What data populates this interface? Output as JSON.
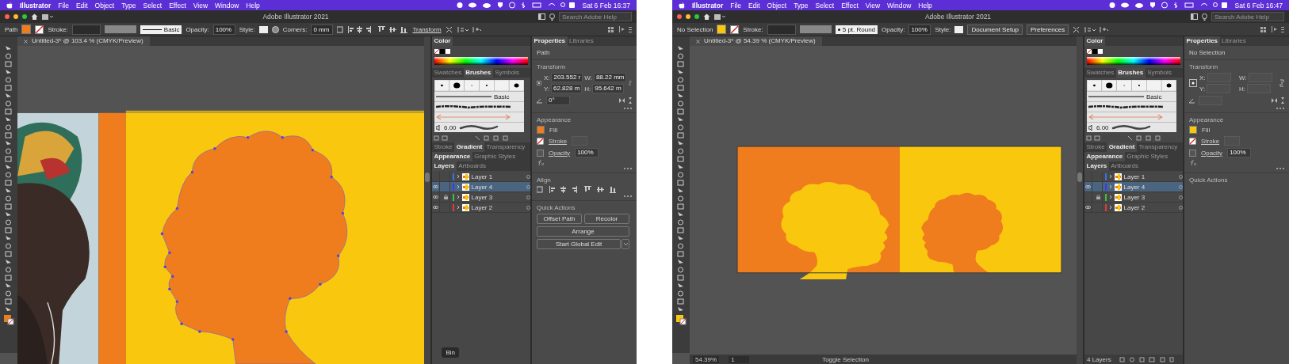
{
  "windows": [
    {
      "menu_bar": {
        "app": "Illustrator",
        "menus": [
          "File",
          "Edit",
          "Object",
          "Type",
          "Select",
          "Effect",
          "View",
          "Window",
          "Help"
        ],
        "clock": "Sat 6 Feb 16:37"
      },
      "title": "Adobe Illustrator 2021",
      "search": {
        "placeholder": "Search Adobe Help"
      },
      "control_bar": [
        {
          "kind": "label",
          "text": "Path"
        },
        {
          "kind": "swatch",
          "color": "#ef7d1d"
        },
        {
          "kind": "no-stroke"
        },
        {
          "kind": "label",
          "text": "Stroke:"
        },
        {
          "kind": "spinner"
        },
        {
          "kind": "grey-field"
        },
        {
          "kind": "brush",
          "text": "Basic"
        },
        {
          "kind": "label",
          "text": "Opacity:"
        },
        {
          "kind": "field",
          "text": "100%"
        },
        {
          "kind": "label",
          "text": "Style:"
        },
        {
          "kind": "style-swatch"
        },
        {
          "kind": "globe"
        },
        {
          "kind": "label",
          "text": "Corners:"
        },
        {
          "kind": "field",
          "text": "0 mm"
        },
        {
          "kind": "align-icons"
        },
        {
          "kind": "link",
          "text": "Transform"
        },
        {
          "kind": "more-icons"
        }
      ],
      "document_tab": "Untitled-3* @ 103.4 % (CMYK/Preview)",
      "artwork": {
        "kind": "portrait-edit"
      },
      "panels": {
        "color_tab": "Color",
        "brush_tabs": [
          {
            "label": "Swatches",
            "selected": false
          },
          {
            "label": "Brushes",
            "selected": true
          },
          {
            "label": "Symbols",
            "selected": false
          }
        ],
        "brush_label": "Basic",
        "brush_size": "6.00",
        "stroke_tabs": [
          {
            "label": "Stroke",
            "selected": false
          },
          {
            "label": "Gradient",
            "selected": true
          },
          {
            "label": "Transparency",
            "selected": false
          }
        ],
        "appearance_tabs": [
          {
            "label": "Appearance",
            "selected": true
          },
          {
            "label": "Graphic Styles",
            "selected": false
          }
        ],
        "layer_tabs": [
          {
            "label": "Layers",
            "selected": true
          },
          {
            "label": "Artboards",
            "selected": false
          }
        ],
        "layers": [
          {
            "name": "Layer 1",
            "visible": false,
            "locked": false,
            "color": "#3f6fe6",
            "selected": false
          },
          {
            "name": "Layer 4",
            "visible": true,
            "locked": false,
            "color": "#3a3af0",
            "selected": true
          },
          {
            "name": "Layer 3",
            "visible": true,
            "locked": true,
            "color": "#3cc23c",
            "selected": false
          },
          {
            "name": "Layer 2",
            "visible": true,
            "locked": false,
            "color": "#e23a3a",
            "selected": false
          }
        ]
      },
      "properties": {
        "tabs": [
          {
            "label": "Properties",
            "selected": true
          },
          {
            "label": "Libraries",
            "selected": false
          }
        ],
        "selection": "Path",
        "transform_title": "Transform",
        "fields": [
          {
            "label": "X:",
            "value": "203.552 r"
          },
          {
            "label": "W:",
            "value": "88.22 mm"
          },
          {
            "label": "Y:",
            "value": "62.828 m"
          },
          {
            "label": "H:",
            "value": "95.642 m"
          }
        ],
        "angle": "0°",
        "appearance_title": "Appearance",
        "fill": {
          "label": "Fill",
          "color": "#ef7d1d"
        },
        "stroke_label": "Stroke",
        "opacity": {
          "label": "Opacity",
          "value": "100%"
        },
        "align_title": "Align",
        "quick_actions_title": "Quick Actions",
        "quick_actions": [
          {
            "label": "Offset Path",
            "kind": "half"
          },
          {
            "label": "Recolor",
            "kind": "half"
          },
          {
            "label": "Arrange",
            "kind": "full"
          },
          {
            "label": "Start Global Edit",
            "kind": "dropdown"
          }
        ]
      },
      "tooltip": "Bin"
    },
    {
      "menu_bar": {
        "app": "Illustrator",
        "menus": [
          "File",
          "Edit",
          "Object",
          "Type",
          "Select",
          "Effect",
          "View",
          "Window",
          "Help"
        ],
        "clock": "Sat 6 Feb 16:47"
      },
      "title": "Adobe Illustrator 2021",
      "search": {
        "placeholder": "Search Adobe Help"
      },
      "control_bar": [
        {
          "kind": "label",
          "text": "No Selection"
        },
        {
          "kind": "swatch",
          "color": "#f9c80e"
        },
        {
          "kind": "no-stroke"
        },
        {
          "kind": "label",
          "text": "Stroke:"
        },
        {
          "kind": "spinner"
        },
        {
          "kind": "grey-field"
        },
        {
          "kind": "brush-dot",
          "text": "5 pt. Round"
        },
        {
          "kind": "label",
          "text": "Opacity:"
        },
        {
          "kind": "field",
          "text": "100%"
        },
        {
          "kind": "label",
          "text": "Style:"
        },
        {
          "kind": "style-swatch"
        },
        {
          "kind": "button",
          "text": "Document Setup"
        },
        {
          "kind": "button",
          "text": "Preferences"
        },
        {
          "kind": "more-icons"
        }
      ],
      "document_tab": "Untitled-3* @ 54.39 % (CMYK/Preview)",
      "artwork": {
        "kind": "artboard-pair"
      },
      "status_bar": {
        "zoom": "54.39%",
        "page": "1",
        "label": "Toggle Selection"
      },
      "panels": {
        "color_tab": "Color",
        "brush_tabs": [
          {
            "label": "Swatches",
            "selected": false
          },
          {
            "label": "Brushes",
            "selected": true
          },
          {
            "label": "Symbols",
            "selected": false
          }
        ],
        "brush_label": "Basic",
        "brush_size": "6.00",
        "stroke_tabs": [
          {
            "label": "Stroke",
            "selected": false
          },
          {
            "label": "Gradient",
            "selected": true
          },
          {
            "label": "Transparency",
            "selected": false
          }
        ],
        "appearance_tabs": [
          {
            "label": "Appearance",
            "selected": true
          },
          {
            "label": "Graphic Styles",
            "selected": false
          }
        ],
        "layer_tabs": [
          {
            "label": "Layers",
            "selected": true
          },
          {
            "label": "Artboards",
            "selected": false
          }
        ],
        "layers": [
          {
            "name": "Layer 1",
            "visible": false,
            "locked": false,
            "color": "#3f6fe6",
            "selected": false
          },
          {
            "name": "Layer 4",
            "visible": true,
            "locked": false,
            "color": "#3a3af0",
            "selected": true
          },
          {
            "name": "Layer 3",
            "visible": false,
            "locked": true,
            "color": "#3cc23c",
            "selected": false
          },
          {
            "name": "Layer 2",
            "visible": true,
            "locked": false,
            "color": "#e23a3a",
            "selected": false
          }
        ],
        "layer_count": "4 Layers"
      },
      "properties": {
        "tabs": [
          {
            "label": "Properties",
            "selected": true
          },
          {
            "label": "Libraries",
            "selected": false
          }
        ],
        "selection": "No Selection",
        "transform_title": "Transform",
        "fields": [
          {
            "label": "X:"
          },
          {
            "label": "W:"
          },
          {
            "label": "Y:"
          },
          {
            "label": "H:"
          }
        ],
        "appearance_title": "Appearance",
        "fill": {
          "label": "Fill",
          "color": "#f9c80e"
        },
        "stroke_label": "Stroke",
        "opacity": {
          "label": "Opacity",
          "value": "100%"
        },
        "quick_actions_title": "Quick Actions"
      }
    }
  ]
}
